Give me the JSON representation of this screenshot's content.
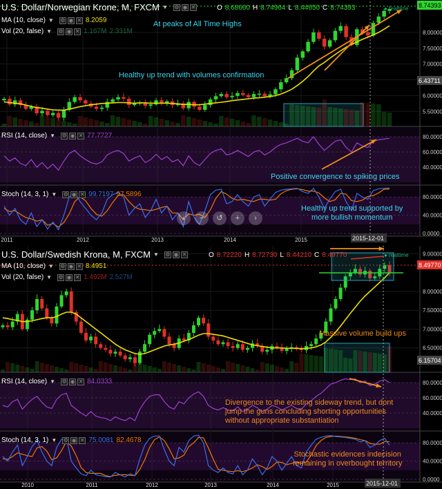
{
  "panel1": {
    "title": "U.S. Dollar/Norwegian Krone, M, FXCM",
    "ohlc": {
      "o_label": "O",
      "o": "8.68660",
      "h_label": "H",
      "h": "8.74964",
      "l_label": "L",
      "l": "8.44650",
      "c_label": "C",
      "c": "8.74393"
    },
    "ma_label": "MA (10, close)",
    "ma_value": "8.2059",
    "vol_label": "Vol (20, false)",
    "vol_v1": "1.167M",
    "vol_v2": "2.331M",
    "rsi_label": "RSI (14, close)",
    "rsi_value": "77.7727",
    "stoch_label": "Stoch (14, 3, 1)",
    "stoch_k": "99.7197",
    "stoch_d": "97.5896",
    "price_ticks": [
      "8.00000",
      "7.50000",
      "7.00000",
      "6.50000",
      "6.00000",
      "5.50000"
    ],
    "price_tag": "8.74393",
    "mid_tag": "6.43711",
    "rsi_ticks": [
      "80.0000",
      "60.0000",
      "40.0000"
    ],
    "stoch_ticks": [
      "80.0000",
      "40.0000",
      "0.0000"
    ],
    "years": [
      "2011",
      "2012",
      "2013",
      "2014",
      "2015"
    ],
    "date_tag": "2015-12-01",
    "realtime": "realtime",
    "annotations": {
      "ath": "At peaks of All Time Highs",
      "trend": "Healthy up trend with volumes confirmation",
      "rsi": "Positive convergence to spiking prices",
      "stoch_l1": "Healthy up trend supported by",
      "stoch_l2": "more bullish momentum"
    }
  },
  "panel2": {
    "title": "U.S. Dollar/Swedish Krona, M, FXCM",
    "ohlc": {
      "o_label": "O",
      "o": "8.72220",
      "h_label": "H",
      "h": "8.72730",
      "l_label": "L",
      "l": "8.44210",
      "c_label": "C",
      "c": "8.49770"
    },
    "ma_label": "MA (10, close)",
    "ma_value": "8.4951",
    "vol_label": "Vol (20, false)",
    "vol_v1": "1.492M",
    "vol_v2": "2.527M",
    "rsi_label": "RSI (14, close)",
    "rsi_value": "84.0333",
    "stoch_label": "Stoch (14, 3, 1)",
    "stoch_k": "75.0081",
    "stoch_d": "82.4678",
    "price_ticks": [
      "9.00000",
      "8.00000",
      "7.50000",
      "7.00000",
      "6.50000"
    ],
    "price_tag": "8.49770",
    "low_tag": "6.15704",
    "rsi_ticks": [
      "80.0000",
      "60.0000",
      "40.0000"
    ],
    "stoch_ticks": [
      "80.0000",
      "40.0000",
      "0.0000"
    ],
    "years": [
      "2010",
      "2011",
      "2012",
      "2013",
      "2014",
      "2015"
    ],
    "date_tag": "2015-12-01",
    "realtime": "realtime",
    "annotations": {
      "vol": "Massive volume build ups",
      "rsi_l1": "Divergence to the existing sideway trend, but dont",
      "rsi_l2": "jump the guns concluding shorting opportunities",
      "rsi_l3": "without appropriate substantiation",
      "stoch_l1": "Stochastic evidences indecision",
      "stoch_l2": "remaining in overbought territory"
    }
  },
  "nav_buttons": [
    "‹",
    "−",
    "↺",
    "+",
    "›"
  ],
  "colors": {
    "bull": "#2fd62f",
    "bear": "#e0302a",
    "ma": "#f0e000",
    "rsi": "#a040d0",
    "stoch_k": "#3a6ee8",
    "stoch_d": "#f07800",
    "annotation_cyan": "#38d8f0",
    "annotation_orange": "#f08a1c",
    "arrow": "#f0901c",
    "background": "#000000"
  },
  "chart_data": [
    {
      "type": "candlestick",
      "title": "U.S. Dollar/Norwegian Krone, M, FXCM",
      "period": "2010-10 to 2015-12 monthly",
      "ylim": [
        5.2,
        8.85
      ],
      "close": [
        5.9,
        5.72,
        5.85,
        5.7,
        5.58,
        5.65,
        5.44,
        5.52,
        5.38,
        5.45,
        5.3,
        5.55,
        5.8,
        5.95,
        5.85,
        5.75,
        5.65,
        5.58,
        5.62,
        5.8,
        5.88,
        5.95,
        5.9,
        5.7,
        5.75,
        5.78,
        5.68,
        5.72,
        5.85,
        5.75,
        5.82,
        5.7,
        5.75,
        5.6,
        5.8,
        5.65,
        5.55,
        5.7,
        5.88,
        5.98,
        6.05,
        5.95,
        5.99,
        6.08,
        6.02,
        5.95,
        6.05,
        6.06,
        5.98,
        6.04,
        6.2,
        6.42,
        6.55,
        6.8,
        7.2,
        7.4,
        7.7,
        8.0,
        7.8,
        7.55,
        7.75,
        8.05,
        8.2,
        7.85,
        7.6,
        8.1,
        8.0,
        7.9,
        8.3,
        8.5,
        8.68,
        8.74
      ],
      "ma": [
        5.8,
        5.78,
        5.76,
        5.74,
        5.7,
        5.66,
        5.62,
        5.6,
        5.57,
        5.55,
        5.54,
        5.54,
        5.57,
        5.61,
        5.65,
        5.68,
        5.71,
        5.73,
        5.75,
        5.76,
        5.77,
        5.78,
        5.78,
        5.77,
        5.76,
        5.77,
        5.77,
        5.76,
        5.76,
        5.76,
        5.76,
        5.75,
        5.74,
        5.72,
        5.72,
        5.71,
        5.71,
        5.73,
        5.75,
        5.77,
        5.79,
        5.81,
        5.84,
        5.86,
        5.88,
        5.9,
        5.92,
        5.93,
        5.95,
        5.97,
        6.0,
        6.05,
        6.12,
        6.2,
        6.32,
        6.45,
        6.6,
        6.78,
        6.94,
        7.05,
        7.18,
        7.3,
        7.42,
        7.53,
        7.62,
        7.7,
        7.78,
        7.85,
        7.92,
        8.0,
        8.1,
        8.21
      ],
      "rsi": [
        55,
        48,
        52,
        45,
        42,
        50,
        40,
        46,
        38,
        44,
        36,
        48,
        58,
        62,
        55,
        50,
        46,
        44,
        47,
        56,
        60,
        62,
        58,
        48,
        52,
        55,
        46,
        50,
        57,
        50,
        54,
        47,
        50,
        42,
        55,
        46,
        42,
        50,
        58,
        62,
        64,
        56,
        58,
        62,
        58,
        54,
        60,
        62,
        56,
        60,
        66,
        70,
        72,
        75,
        78,
        74,
        72,
        80,
        70,
        62,
        68,
        74,
        76,
        66,
        60,
        72,
        68,
        66,
        74,
        76,
        77,
        78
      ],
      "stoch_k": [
        60,
        40,
        55,
        30,
        20,
        45,
        15,
        30,
        10,
        25,
        8,
        40,
        80,
        90,
        70,
        55,
        40,
        30,
        45,
        75,
        85,
        90,
        80,
        40,
        55,
        65,
        35,
        50,
        75,
        45,
        60,
        30,
        45,
        15,
        70,
        35,
        20,
        50,
        85,
        95,
        97,
        65,
        70,
        85,
        70,
        60,
        80,
        85,
        60,
        75,
        90,
        95,
        97,
        98,
        99,
        92,
        88,
        99,
        80,
        55,
        75,
        92,
        97,
        70,
        50,
        88,
        80,
        75,
        94,
        98,
        99,
        99.7
      ],
      "stoch_d": [
        55,
        48,
        50,
        42,
        35,
        32,
        27,
        30,
        18,
        22,
        14,
        24,
        43,
        70,
        80,
        72,
        55,
        42,
        38,
        50,
        68,
        83,
        85,
        70,
        58,
        53,
        52,
        50,
        53,
        57,
        60,
        45,
        45,
        30,
        43,
        40,
        42,
        35,
        52,
        77,
        92,
        86,
        77,
        73,
        75,
        72,
        70,
        75,
        75,
        73,
        75,
        87,
        94,
        97,
        98,
        96,
        93,
        93,
        89,
        78,
        70,
        74,
        88,
        86,
        72,
        70,
        73,
        81,
        83,
        89,
        97,
        97.6
      ]
    },
    {
      "type": "candlestick",
      "title": "U.S. Dollar/Swedish Krona, M, FXCM",
      "period": "2009-09 to 2015-12 monthly",
      "ylim": [
        6.0,
        9.1
      ],
      "close": [
        7.1,
        7.05,
        7.2,
        7.4,
        7.0,
        7.25,
        7.5,
        7.8,
        7.55,
        7.3,
        7.15,
        7.6,
        7.9,
        8.0,
        7.45,
        7.2,
        6.9,
        6.7,
        6.8,
        6.6,
        6.5,
        6.45,
        6.35,
        6.4,
        6.3,
        6.2,
        6.25,
        6.1,
        6.4,
        6.6,
        6.85,
        6.95,
        7.0,
        6.8,
        6.6,
        6.5,
        6.75,
        6.7,
        6.9,
        7.1,
        7.3,
        7.15,
        6.8,
        6.7,
        6.6,
        6.65,
        6.55,
        6.5,
        6.6,
        6.45,
        6.5,
        6.62,
        6.55,
        6.4,
        6.45,
        6.55,
        6.5,
        6.42,
        6.48,
        6.52,
        6.47,
        6.44,
        6.55,
        6.6,
        6.75,
        6.9,
        7.2,
        7.55,
        7.8,
        8.1,
        8.4,
        8.5,
        8.6,
        8.45,
        8.55,
        8.35,
        8.4,
        8.6,
        8.7,
        8.5
      ],
      "ma": [
        7.3,
        7.28,
        7.25,
        7.23,
        7.2,
        7.2,
        7.22,
        7.25,
        7.28,
        7.3,
        7.3,
        7.33,
        7.4,
        7.45,
        7.45,
        7.4,
        7.3,
        7.2,
        7.1,
        7.0,
        6.9,
        6.8,
        6.7,
        6.6,
        6.52,
        6.45,
        6.4,
        6.35,
        6.33,
        6.35,
        6.4,
        6.45,
        6.5,
        6.55,
        6.58,
        6.6,
        6.63,
        6.68,
        6.72,
        6.78,
        6.84,
        6.88,
        6.88,
        6.86,
        6.84,
        6.82,
        6.78,
        6.74,
        6.7,
        6.66,
        6.62,
        6.58,
        6.56,
        6.54,
        6.52,
        6.5,
        6.5,
        6.5,
        6.49,
        6.49,
        6.49,
        6.48,
        6.49,
        6.5,
        6.53,
        6.58,
        6.66,
        6.78,
        6.92,
        7.08,
        7.25,
        7.42,
        7.58,
        7.74,
        7.88,
        8.0,
        8.12,
        8.24,
        8.36,
        8.5
      ],
      "rsi": [
        50,
        48,
        55,
        58,
        45,
        52,
        58,
        62,
        54,
        48,
        46,
        58,
        64,
        66,
        50,
        45,
        40,
        36,
        42,
        36,
        34,
        33,
        30,
        35,
        32,
        30,
        34,
        30,
        45,
        55,
        62,
        64,
        64,
        55,
        48,
        45,
        55,
        52,
        60,
        65,
        68,
        62,
        50,
        46,
        44,
        47,
        44,
        43,
        48,
        42,
        45,
        50,
        47,
        42,
        45,
        50,
        48,
        44,
        47,
        50,
        46,
        45,
        52,
        56,
        62,
        66,
        72,
        78,
        80,
        83,
        85,
        84,
        85,
        80,
        82,
        76,
        78,
        82,
        84,
        80
      ],
      "stoch_k": [
        50,
        40,
        60,
        75,
        30,
        50,
        72,
        85,
        60,
        40,
        30,
        70,
        88,
        92,
        40,
        25,
        12,
        8,
        20,
        10,
        8,
        6,
        5,
        15,
        10,
        5,
        12,
        8,
        45,
        75,
        90,
        95,
        95,
        65,
        40,
        30,
        70,
        60,
        85,
        95,
        97,
        80,
        30,
        20,
        15,
        25,
        15,
        12,
        30,
        10,
        20,
        45,
        30,
        10,
        25,
        50,
        40,
        20,
        35,
        50,
        30,
        25,
        60,
        75,
        88,
        92,
        95,
        96,
        94,
        93,
        92,
        90,
        88,
        82,
        85,
        70,
        75,
        85,
        90,
        75
      ],
      "stoch_d": [
        45,
        44,
        50,
        58,
        55,
        52,
        50,
        69,
        72,
        62,
        43,
        47,
        63,
        83,
        73,
        52,
        26,
        15,
        13,
        13,
        13,
        8,
        6,
        9,
        10,
        10,
        9,
        8,
        22,
        43,
        70,
        87,
        93,
        85,
        67,
        45,
        47,
        53,
        72,
        80,
        92,
        91,
        69,
        44,
        22,
        20,
        18,
        17,
        19,
        17,
        20,
        25,
        32,
        28,
        22,
        28,
        38,
        37,
        32,
        35,
        38,
        35,
        38,
        53,
        74,
        85,
        92,
        94,
        95,
        94,
        93,
        92,
        90,
        87,
        85,
        79,
        77,
        77,
        83,
        82.5
      ]
    }
  ]
}
